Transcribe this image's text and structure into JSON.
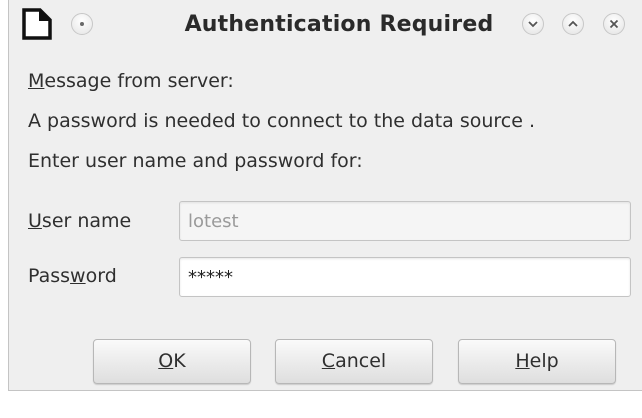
{
  "window": {
    "title": "Authentication Required"
  },
  "message": {
    "heading_pre": "",
    "heading_mnemonic": "M",
    "heading_post": "essage from server:",
    "body": "A password is needed to connect to the data source .",
    "prompt": "Enter user name and password for:"
  },
  "form": {
    "user_label_mnemonic": "U",
    "user_label_post": "ser name",
    "user_value": "lotest",
    "password_label_pre": "Pass",
    "password_label_mnemonic": "w",
    "password_label_post": "ord",
    "password_value": "*****"
  },
  "buttons": {
    "ok_mnemonic": "O",
    "ok_post": "K",
    "cancel_mnemonic": "C",
    "cancel_post": "ancel",
    "help_mnemonic": "H",
    "help_post": "elp"
  },
  "icons": {
    "app": "document-icon",
    "menu": "window-menu-icon",
    "minimize": "minimize-icon",
    "maximize": "maximize-icon",
    "close": "close-icon"
  },
  "colors": {
    "dialog_bg": "#efefef",
    "text": "#2f2f2f",
    "disabled_text": "#9a9a9a"
  }
}
